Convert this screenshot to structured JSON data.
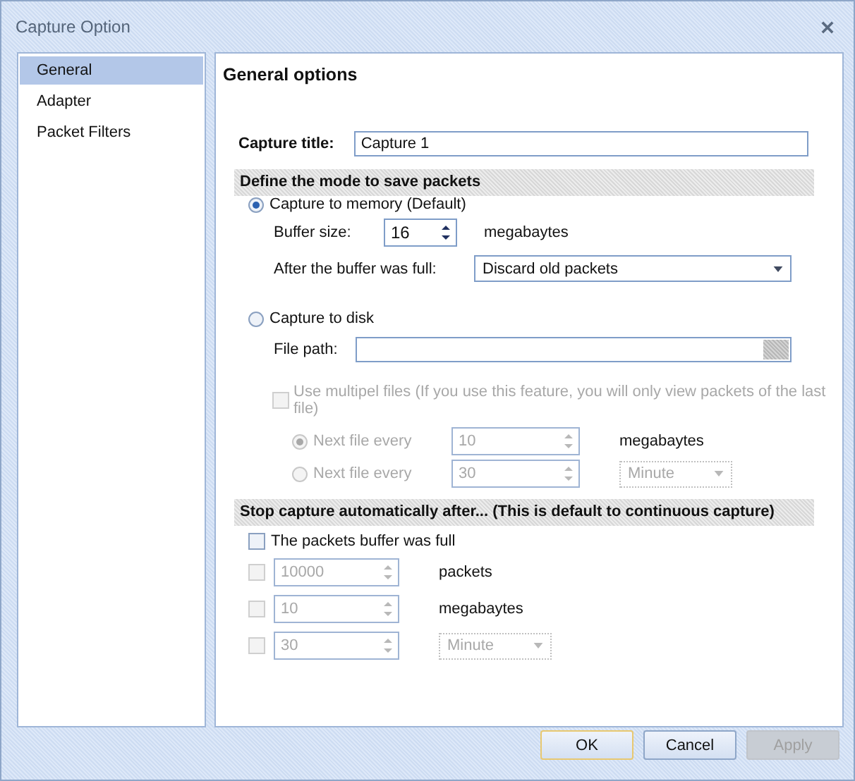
{
  "window": {
    "title": "Capture Option"
  },
  "sidebar": {
    "items": [
      {
        "label": "General",
        "selected": true
      },
      {
        "label": "Adapter",
        "selected": false
      },
      {
        "label": "Packet Filters",
        "selected": false
      }
    ]
  },
  "panel": {
    "heading": "General options",
    "capture_title": {
      "label": "Capture title:",
      "value": "Capture 1"
    },
    "save_mode": {
      "heading": "Define the mode to save packets",
      "memory": {
        "label": "Capture to memory (Default)",
        "selected": true,
        "buffer_size": {
          "label": "Buffer size:",
          "value": "16",
          "unit": "megabaytes"
        },
        "after_full": {
          "label": "After the buffer was full:",
          "value": "Discard old packets"
        }
      },
      "disk": {
        "label": "Capture to disk",
        "selected": false,
        "file_path": {
          "label": "File path:"
        },
        "multiple_files": {
          "label": "Use multipel files (If you use this feature, you will only view packets of the last file)",
          "checked": false,
          "disabled": true
        },
        "next_file": [
          {
            "label": "Next file every",
            "selected": true,
            "disabled": true,
            "value": "10",
            "unit": "megabaytes",
            "kind": "text"
          },
          {
            "label": "Next file every",
            "selected": false,
            "disabled": true,
            "value": "30",
            "unit": "Minute",
            "kind": "dropdown"
          }
        ]
      }
    },
    "stop": {
      "heading": "Stop capture automatically after... (This is default to continuous capture)",
      "buffer_full": {
        "label": "The packets buffer was full",
        "checked": false
      },
      "limits": [
        {
          "checked": false,
          "disabled": true,
          "value": "10000",
          "unit": "packets",
          "kind": "text"
        },
        {
          "checked": false,
          "disabled": true,
          "value": "10",
          "unit": "megabaytes",
          "kind": "text"
        },
        {
          "checked": false,
          "disabled": true,
          "value": "30",
          "unit": "Minute",
          "kind": "dropdown"
        }
      ]
    }
  },
  "buttons": [
    {
      "label": "OK",
      "default": true,
      "disabled": false
    },
    {
      "label": "Cancel",
      "default": false,
      "disabled": false
    },
    {
      "label": "Apply",
      "default": false,
      "disabled": true
    }
  ]
}
